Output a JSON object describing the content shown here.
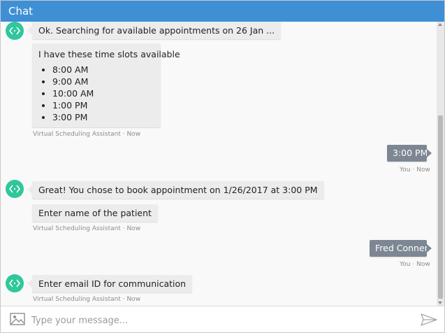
{
  "window": {
    "title": "Chat"
  },
  "messages": {
    "bot1": {
      "text": "Ok. Searching for available appointments on 26 Jan ..."
    },
    "bot2": {
      "intro": "I have these time slots available",
      "slots": [
        "8:00 AM",
        "9:00 AM",
        "10:00 AM",
        "1:00 PM",
        "3:00 PM"
      ],
      "meta": "Virtual Scheduling Assistant · Now"
    },
    "user1": {
      "text": "3:00 PM",
      "meta": "You · Now"
    },
    "bot3": {
      "text": "Great! You chose to book appointment on 1/26/2017 at 3:00 PM"
    },
    "bot4": {
      "text": "Enter name of the patient",
      "meta": "Virtual Scheduling Assistant · Now"
    },
    "user2": {
      "text": "Fred Conners",
      "meta": "You · Now"
    },
    "bot5": {
      "text": "Enter email ID for communication",
      "meta": "Virtual Scheduling Assistant · Now"
    }
  },
  "input": {
    "placeholder": "Type your message..."
  },
  "icons": {
    "avatar": "code-brackets-icon",
    "attach": "image-icon",
    "send": "send-icon"
  },
  "colors": {
    "titlebar": "#3f8fd4",
    "bot_avatar": "#2fc79b",
    "bot_bubble": "#ececec",
    "user_bubble": "#7d8793"
  }
}
